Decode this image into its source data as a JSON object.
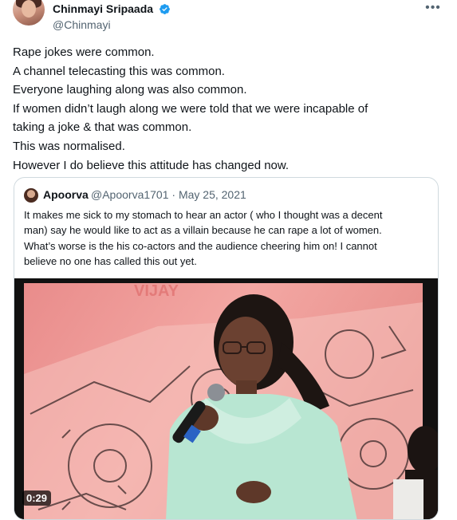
{
  "author": {
    "name": "Chinmayi Sripaada",
    "handle": "@Chinmayi",
    "verified_color": "#1d9bf0"
  },
  "tweet": {
    "lines": [
      "Rape jokes were common.",
      "A channel telecasting this was common.",
      "Everyone laughing along was also common.",
      "If women didn’t laugh along we were told that we were incapable of",
      "taking a joke & that was common.",
      "This was normalised.",
      "However I do believe this attitude has changed now."
    ]
  },
  "quoted_tweet": {
    "name": "Apoorva",
    "meta": "@Apoorva1701 · May 25, 2021",
    "lines": [
      "It makes me sick to my stomach to hear an actor ( who I thought was a decent",
      "man) say he would like to act as a villain because he can rape a lot of women.",
      "What’s worse is the his co-actors and the audience cheering him on! I cannot",
      "believe no one has called this out yet."
    ],
    "video_duration": "0:29"
  },
  "icons": {
    "more": "more-horizontal-icon",
    "verified": "verified-badge-icon"
  }
}
